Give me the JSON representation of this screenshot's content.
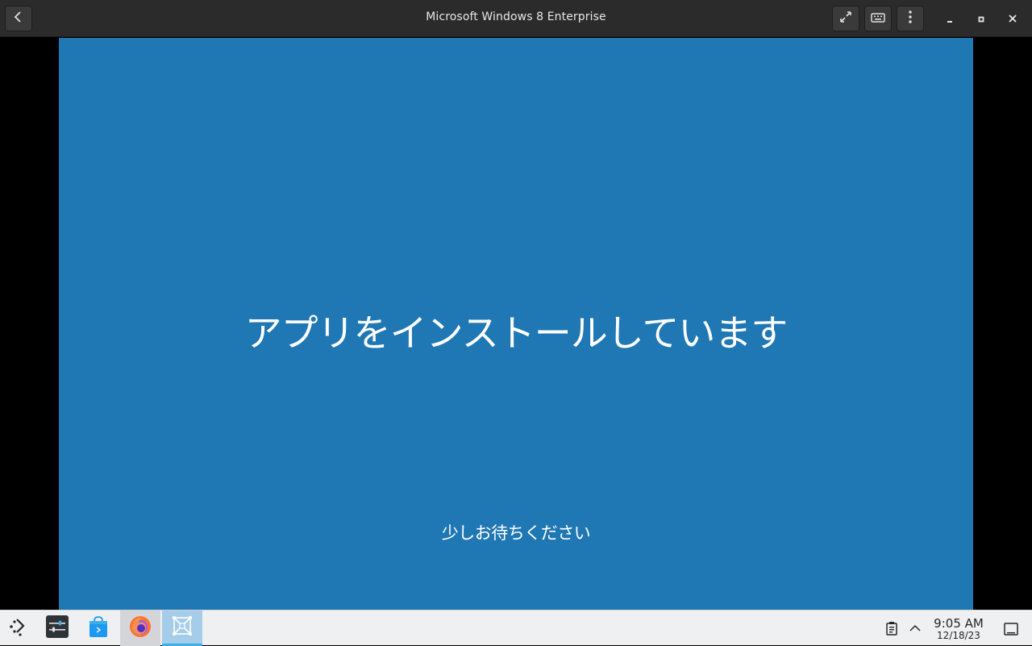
{
  "window": {
    "title": "Microsoft Windows 8 Enterprise"
  },
  "titlebar_icons": {
    "back": "chevron-left-icon",
    "fullscreen": "fullscreen-icon",
    "keyboard": "keyboard-icon",
    "menu": "kebab-menu-icon",
    "minimize": "minimize-icon",
    "maximize": "maximize-icon",
    "close": "close-icon"
  },
  "vm_screen": {
    "heading": "アプリをインストールしています",
    "subtext": "少しお待ちください",
    "background_color": "#1f77b4"
  },
  "taskbar": {
    "apps": [
      {
        "name": "application-launcher",
        "icon": "launcher-icon"
      },
      {
        "name": "system-settings",
        "icon": "settings-icon"
      },
      {
        "name": "discover-store",
        "icon": "store-icon"
      },
      {
        "name": "firefox",
        "icon": "firefox-icon"
      },
      {
        "name": "virtual-machine",
        "icon": "vm-icon",
        "active": true
      }
    ],
    "tray": {
      "clipboard_icon": "clipboard-icon",
      "expand_icon": "chevron-up-icon",
      "time": "9:05 AM",
      "date": "12/18/23",
      "show_desktop_icon": "show-desktop-icon"
    },
    "accent_color": "#3daee9"
  }
}
